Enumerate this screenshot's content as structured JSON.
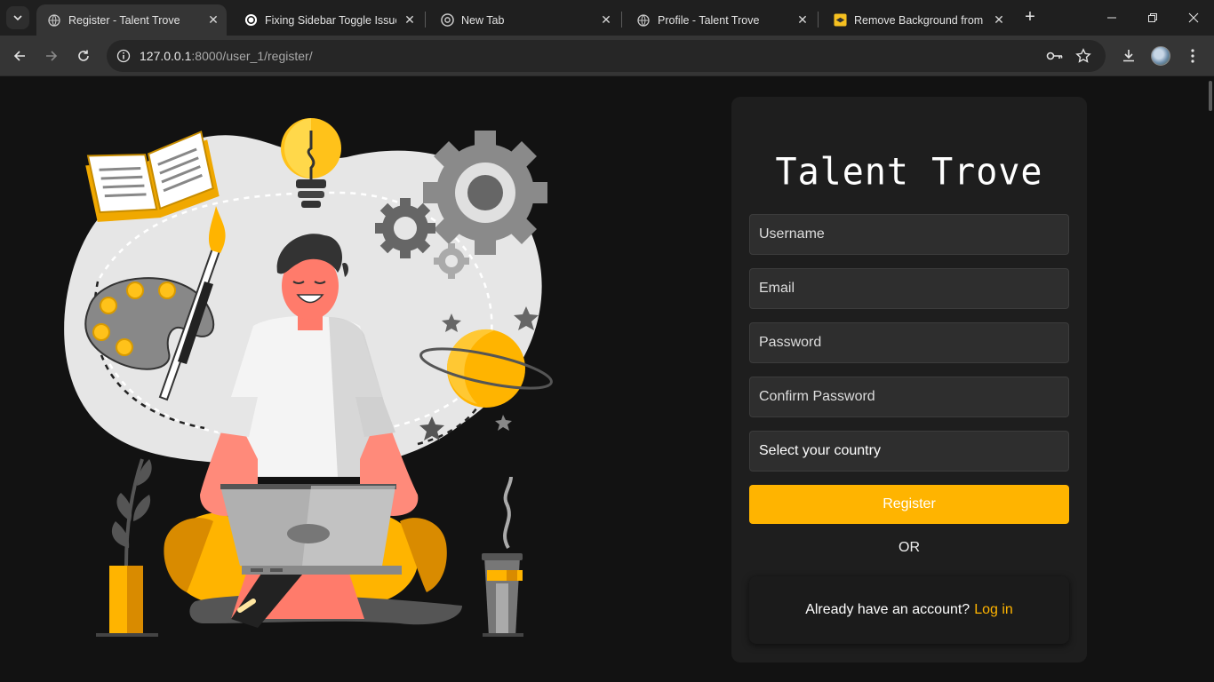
{
  "browser": {
    "tabs": [
      {
        "title": "Register - Talent Trove",
        "active": true,
        "favicon": "globe-icon"
      },
      {
        "title": "Fixing Sidebar Toggle Issue",
        "active": false,
        "favicon": "openai-icon"
      },
      {
        "title": "New Tab",
        "active": false,
        "favicon": "chrome-icon"
      },
      {
        "title": "Profile - Talent Trove",
        "active": false,
        "favicon": "globe-icon"
      },
      {
        "title": "Remove Background from Im",
        "active": false,
        "favicon": "removebg-icon"
      }
    ],
    "url_host": "127.0.0.1",
    "url_rest": ":8000/user_1/register/"
  },
  "page": {
    "logo": "Talent Trove",
    "form": {
      "username_placeholder": "Username",
      "email_placeholder": "Email",
      "password_placeholder": "Password",
      "confirm_password_placeholder": "Confirm Password",
      "country_select": "Select your country",
      "register_label": "Register",
      "or_text": "OR",
      "have_account_text": "Already have an account?",
      "login_link": "Log in"
    },
    "colors": {
      "accent": "#ffb400",
      "card_bg": "#1e1e1e",
      "page_bg": "#121212"
    }
  }
}
